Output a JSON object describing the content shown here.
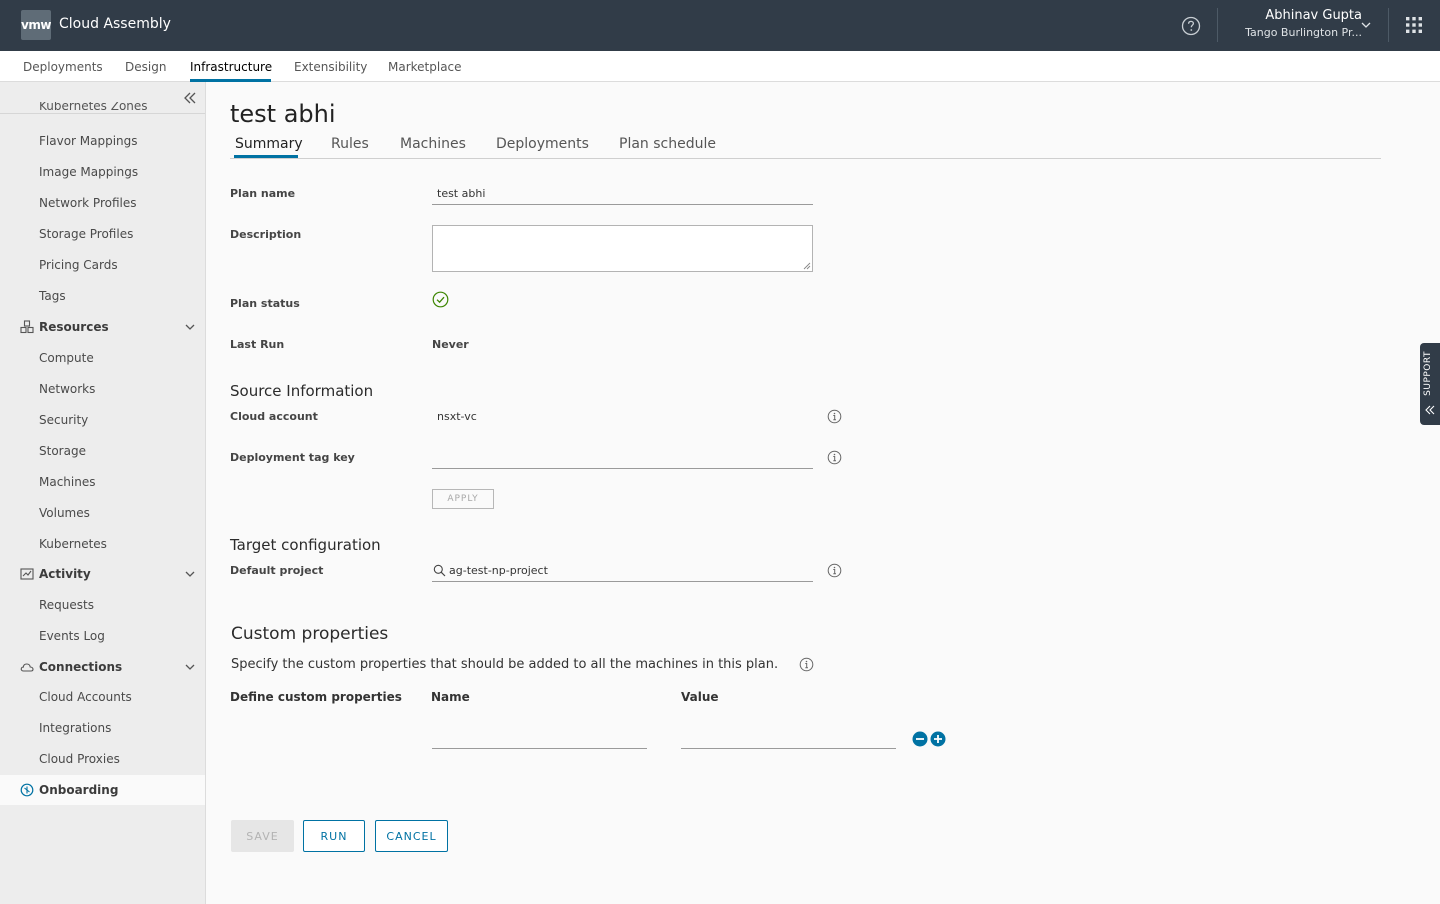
{
  "header": {
    "logo_text": "vmw",
    "app_title": "Cloud Assembly",
    "user_name": "Abhinav Gupta",
    "user_org": "Tango Burlington Pr..."
  },
  "topnav": [
    "Deployments",
    "Design",
    "Infrastructure",
    "Extensibility",
    "Marketplace"
  ],
  "sidebar": {
    "clipped_item": "Kubernetes Zones",
    "items_top": [
      "Flavor Mappings",
      "Image Mappings",
      "Network Profiles",
      "Storage Profiles",
      "Pricing Cards",
      "Tags"
    ],
    "resources": {
      "label": "Resources",
      "items": [
        "Compute",
        "Networks",
        "Security",
        "Storage",
        "Machines",
        "Volumes",
        "Kubernetes"
      ]
    },
    "activity": {
      "label": "Activity",
      "items": [
        "Requests",
        "Events Log"
      ]
    },
    "connections": {
      "label": "Connections",
      "items": [
        "Cloud Accounts",
        "Integrations",
        "Cloud Proxies"
      ]
    },
    "onboarding": "Onboarding"
  },
  "page": {
    "title": "test abhi",
    "tabs": [
      "Summary",
      "Rules",
      "Machines",
      "Deployments",
      "Plan schedule"
    ]
  },
  "form": {
    "plan_name_label": "Plan name",
    "plan_name_value": "test abhi",
    "description_label": "Description",
    "plan_status_label": "Plan status",
    "last_run_label": "Last Run",
    "last_run_value": "Never",
    "source_section": "Source Information",
    "cloud_account_label": "Cloud account",
    "cloud_account_value": "nsxt-vc",
    "deployment_tag_label": "Deployment tag key",
    "apply_label": "APPLY",
    "target_section": "Target configuration",
    "default_project_label": "Default project",
    "default_project_value": "ag-test-np-project"
  },
  "custom_props": {
    "title": "Custom properties",
    "description": "Specify the custom properties that should be added to all the machines in this plan.",
    "define_label": "Define custom properties",
    "name_header": "Name",
    "value_header": "Value"
  },
  "buttons": {
    "save": "SAVE",
    "run": "RUN",
    "cancel": "CANCEL"
  },
  "support_label": "SUPPORT",
  "colors": {
    "header_bg": "#313c48",
    "accent": "#0072a3",
    "success": "#3c8500"
  }
}
